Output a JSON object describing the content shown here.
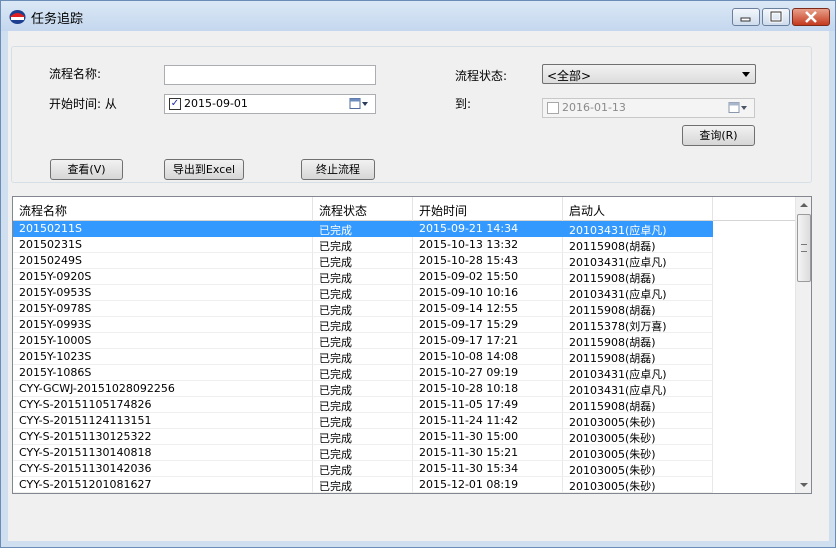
{
  "window": {
    "title": "任务追踪"
  },
  "filters": {
    "process_name_label": "流程名称:",
    "process_name_value": "",
    "process_status_label": "流程状态:",
    "process_status_selected": "<全部>",
    "start_time_label": "开始时间: 从",
    "start_date": "2015-09-01",
    "start_date_checked": true,
    "to_label": "到:",
    "end_date": "2016-01-13",
    "end_date_checked": false,
    "query_button": "查询(R)"
  },
  "toolbar": {
    "view_button": "查看(V)",
    "export_button": "导出到Excel",
    "terminate_button": "终止流程"
  },
  "table": {
    "columns": [
      "流程名称",
      "流程状态",
      "开始时间",
      "启动人"
    ],
    "selected_row": 0,
    "rows": [
      [
        "20150211S",
        "已完成",
        "2015-09-21 14:34",
        "20103431(应卓凡)"
      ],
      [
        "20150231S",
        "已完成",
        "2015-10-13 13:32",
        "20115908(胡磊)"
      ],
      [
        "20150249S",
        "已完成",
        "2015-10-28 15:43",
        "20103431(应卓凡)"
      ],
      [
        "2015Y-0920S",
        "已完成",
        "2015-09-02 15:50",
        "20115908(胡磊)"
      ],
      [
        "2015Y-0953S",
        "已完成",
        "2015-09-10 10:16",
        "20103431(应卓凡)"
      ],
      [
        "2015Y-0978S",
        "已完成",
        "2015-09-14 12:55",
        "20115908(胡磊)"
      ],
      [
        "2015Y-0993S",
        "已完成",
        "2015-09-17 15:29",
        "20115378(刘万喜)"
      ],
      [
        "2015Y-1000S",
        "已完成",
        "2015-09-17 17:21",
        "20115908(胡磊)"
      ],
      [
        "2015Y-1023S",
        "已完成",
        "2015-10-08 14:08",
        "20115908(胡磊)"
      ],
      [
        "2015Y-1086S",
        "已完成",
        "2015-10-27 09:19",
        "20103431(应卓凡)"
      ],
      [
        "CYY-GCWJ-20151028092256",
        "已完成",
        "2015-10-28 10:18",
        "20103431(应卓凡)"
      ],
      [
        "CYY-S-20151105174826",
        "已完成",
        "2015-11-05 17:49",
        "20115908(胡磊)"
      ],
      [
        "CYY-S-20151124113151",
        "已完成",
        "2015-11-24 11:42",
        "20103005(朱砂)"
      ],
      [
        "CYY-S-20151130125322",
        "已完成",
        "2015-11-30 15:00",
        "20103005(朱砂)"
      ],
      [
        "CYY-S-20151130140818",
        "已完成",
        "2015-11-30 15:21",
        "20103005(朱砂)"
      ],
      [
        "CYY-S-20151130142036",
        "已完成",
        "2015-11-30 15:34",
        "20103005(朱砂)"
      ],
      [
        "CYY-S-20151201081627",
        "已完成",
        "2015-12-01 08:19",
        "20103005(朱砂)"
      ]
    ]
  },
  "icons": {
    "app": "app-logo-icon",
    "calendar": "calendar-icon"
  },
  "colors": {
    "selection": "#3399ff",
    "window_frame": "#cfdff0"
  }
}
